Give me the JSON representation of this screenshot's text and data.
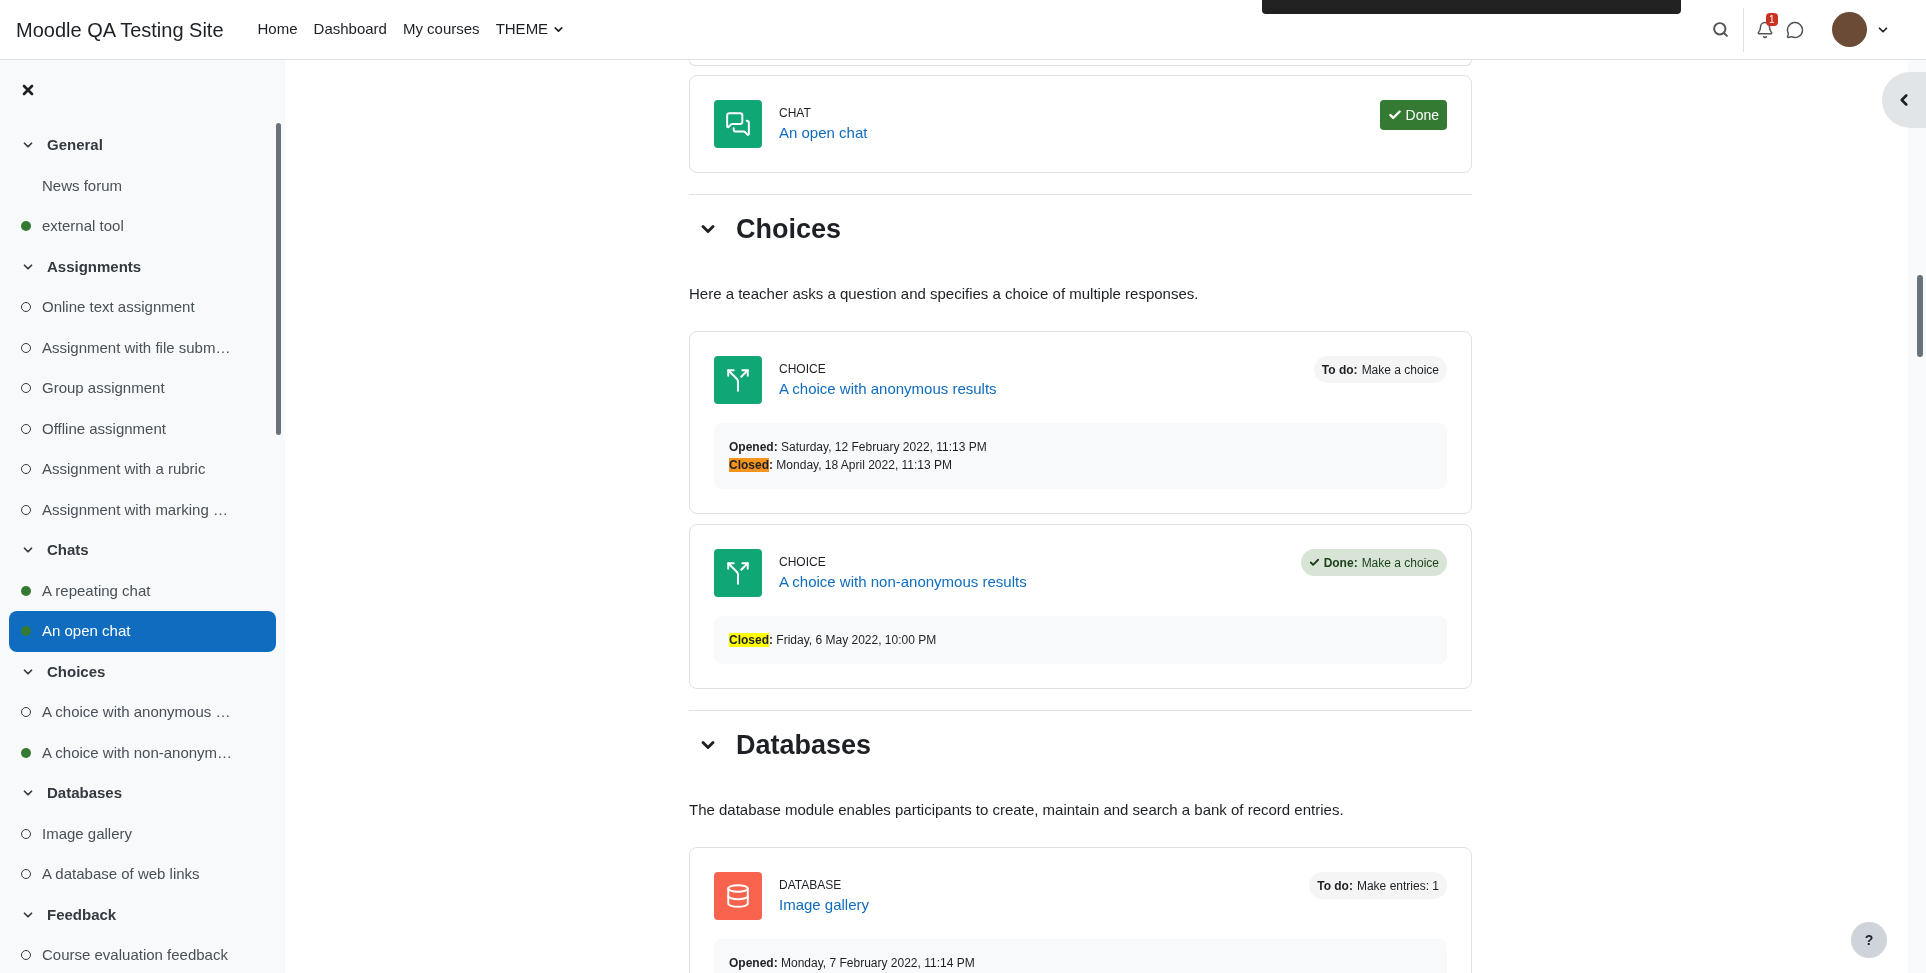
{
  "header": {
    "site_name": "Moodle QA Testing Site",
    "nav": [
      {
        "label": "Home",
        "dropdown": false
      },
      {
        "label": "Dashboard",
        "dropdown": false
      },
      {
        "label": "My courses",
        "dropdown": false
      },
      {
        "label": "THEME",
        "dropdown": true
      }
    ],
    "notification_count": "1"
  },
  "sidebar": {
    "sections": [
      {
        "title": "General",
        "expanded": true,
        "items": [
          {
            "label": "News forum",
            "selected": false
          },
          {
            "label": "external tool",
            "completed": true,
            "selected": false
          }
        ]
      },
      {
        "title": "Assignments",
        "expanded": true,
        "items": [
          {
            "label": "Online text assignment",
            "completed": false,
            "selected": false
          },
          {
            "label": "Assignment with file subm…",
            "completed": false,
            "selected": false
          },
          {
            "label": "Group assignment",
            "completed": false,
            "selected": false
          },
          {
            "label": "Offline assignment",
            "completed": false,
            "selected": false
          },
          {
            "label": "Assignment with a rubric",
            "completed": false,
            "selected": false
          },
          {
            "label": "Assignment with marking …",
            "completed": false,
            "selected": false
          }
        ]
      },
      {
        "title": "Chats",
        "expanded": true,
        "items": [
          {
            "label": "A repeating chat",
            "completed": true,
            "selected": false
          },
          {
            "label": "An open chat",
            "completed": true,
            "selected": true
          }
        ]
      },
      {
        "title": "Choices",
        "expanded": true,
        "items": [
          {
            "label": "A choice with anonymous …",
            "completed": false,
            "selected": false
          },
          {
            "label": "A choice with non-anonym…",
            "completed": true,
            "selected": false
          }
        ]
      },
      {
        "title": "Databases",
        "expanded": true,
        "items": [
          {
            "label": "Image gallery",
            "completed": false,
            "selected": false
          },
          {
            "label": "A database of web links",
            "completed": false,
            "selected": false
          }
        ]
      },
      {
        "title": "Feedback",
        "expanded": true,
        "items": [
          {
            "label": "Course evaluation feedback",
            "completed": false,
            "selected": false
          }
        ]
      }
    ]
  },
  "sections": [
    {
      "activities": [
        {
          "kind": "chat",
          "type_label": "CHAT",
          "name": "An open chat",
          "status": {
            "kind": "button",
            "label": "Done"
          }
        }
      ]
    },
    {
      "title": "Choices",
      "expanded": true,
      "description": "Here a teacher asks a question and specifies a choice of multiple responses.",
      "activities": [
        {
          "kind": "choice",
          "type_label": "CHOICE",
          "name": "A choice with anonymous results",
          "status": {
            "kind": "todo",
            "label": "To do:",
            "text": "Make a choice"
          },
          "dates": [
            {
              "label": "Opened",
              "punct": ":",
              "value": "Saturday, 12 February 2022, 11:13 PM"
            },
            {
              "label": "Closed",
              "punct": ":",
              "value": "Monday, 18 April 2022, 11:13 PM",
              "color": "#f7941d"
            }
          ]
        },
        {
          "kind": "choice",
          "type_label": "CHOICE",
          "name": "A choice with non-anonymous results",
          "status": {
            "kind": "done",
            "label": "Done:",
            "text": "Make a choice"
          },
          "dates": [
            {
              "label": "Closed",
              "punct": ":",
              "value": "Friday, 6 May 2022, 10:00 PM",
              "color": "#ffff00"
            }
          ]
        }
      ]
    },
    {
      "title": "Databases",
      "expanded": true,
      "description": "The database module enables participants to create, maintain and search a bank of record entries.",
      "activities": [
        {
          "kind": "database",
          "type_label": "DATABASE",
          "name": "Image gallery",
          "status": {
            "kind": "todo",
            "label": "To do:",
            "text": "Make entries: 1"
          },
          "dates": [
            {
              "label": "Opened",
              "punct": ":",
              "value": "Monday, 7 February 2022, 11:14 PM"
            }
          ]
        }
      ]
    }
  ],
  "help_button": "?"
}
